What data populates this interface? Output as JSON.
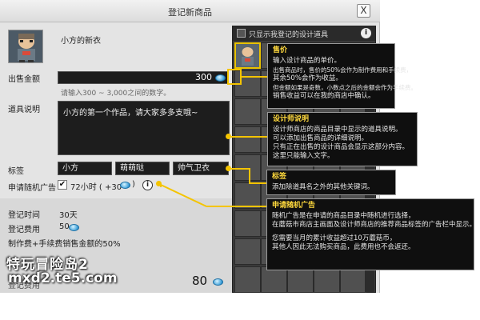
{
  "dialog": {
    "title": "登记新商品",
    "close_glyph": "X",
    "item_name": "小方的新衣",
    "price_label": "出售金额",
    "price_value": "300",
    "price_hint": "请输入300 ~ 3,000之间的数字。",
    "desc_label": "道具说明",
    "desc_value": "小方的第一个作品，请大家多多支哦~",
    "tag_label": "标签",
    "tags": [
      "小方",
      "萌萌哒",
      "帅气卫衣"
    ],
    "ad_label": "申请随机广告",
    "ad_check": "✔",
    "ad_text": "72小时 ( +30",
    "ad_close": ")",
    "reg_time_label": "登记时间",
    "reg_time_value": "30天",
    "reg_fee_label": "登记费用",
    "reg_fee_value": "50",
    "fee_note": "制作费+手续费销售金额的50%",
    "total_label": "登记费用",
    "total_value": "80"
  },
  "grid": {
    "header_text": "只显示我登记的设计道具",
    "info_glyph": "i"
  },
  "tooltips": {
    "price": {
      "title": "售价",
      "lines": [
        "输入设计商品的单价。",
        "出售商品时，售价的50%会作为制作费用和手续费，",
        "其余50%会作为收益。",
        "但金额如果是奇数，小数点之后的金额会作为手续费。",
        "销售收益可以在我的商店中确认。"
      ]
    },
    "desc": {
      "title": "设计师说明",
      "lines": [
        "设计师商店的商品目录中显示的道具说明。",
        "可以添加出售商品的详细说明。",
        "只有正在出售的设计商品会显示这部分内容。",
        "这里只能输入文字。"
      ]
    },
    "tag": {
      "title": "标签",
      "lines": [
        "添加除道具名之外的其他关键词。"
      ]
    },
    "ad": {
      "title": "申请随机广告",
      "lines": [
        "随机广告是在申请的商品目录中随机进行选择，",
        "在蘑菇市商店主画面及设计师商店的推荐商品标签的广告栏中显示。",
        "",
        "您需要当月的累计收益超过10万蘑菇币，",
        "其他人因此无法购买商品，此费用也不会返还。"
      ]
    }
  },
  "watermark": {
    "line1": "特玩冒险岛2",
    "line2": "mxd2.te5.com"
  },
  "colors": {
    "highlight": "#f4c400",
    "tooltip_bg": "#0f0f0f",
    "coin": "#3d9fd9"
  }
}
